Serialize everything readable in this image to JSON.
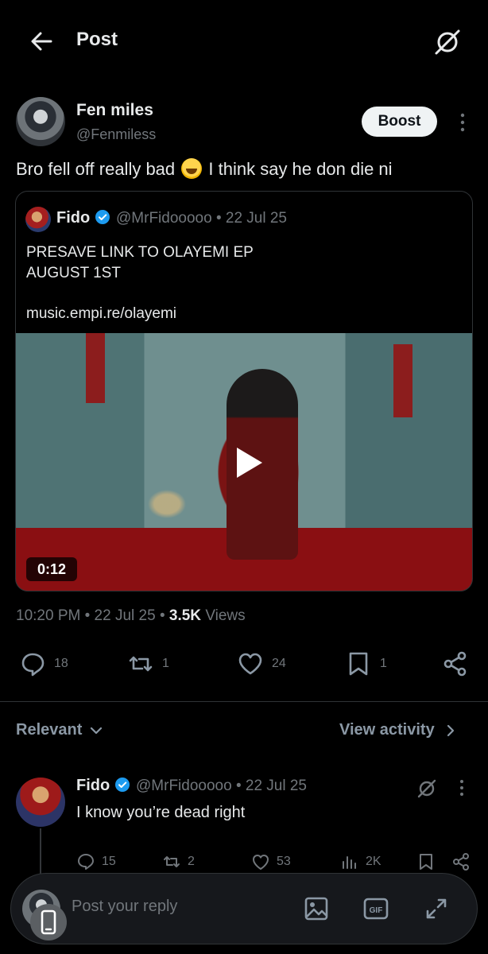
{
  "header": {
    "title": "Post",
    "back_icon": "arrow-left-icon",
    "grok_icon": "grok-icon"
  },
  "author": {
    "name": "Fen miles",
    "handle": "@Fenmiless",
    "boost_label": "Boost"
  },
  "post": {
    "text_before": "Bro fell off really bad",
    "emoji": "grinning-squinting-face-emoji",
    "text_after": "I think say he don die ni",
    "time": "10:20 PM",
    "date": "22 Jul 25",
    "views_count": "3.5K",
    "views_label": "Views"
  },
  "quote": {
    "name": "Fido",
    "handle_date": "@MrFidooooo • 22 Jul 25",
    "line1": "PRESAVE LINK TO OLAYEMI EP",
    "line2": "AUGUST 1ST",
    "link": "music.empi.re/olayemi",
    "video_duration": "0:12"
  },
  "actions": {
    "replies": "18",
    "reposts": "1",
    "likes": "24",
    "bookmarks": "1"
  },
  "replies_header": {
    "sort_label": "Relevant",
    "activity_label": "View activity"
  },
  "reply": {
    "name": "Fido",
    "handle_date": "@MrFidooooo • 22 Jul 25",
    "text": "I know you’re dead right",
    "replies": "15",
    "reposts": "2",
    "likes": "53",
    "views": "2K"
  },
  "composer": {
    "placeholder": "Post your reply"
  },
  "colors": {
    "background": "#000000",
    "muted": "#71767b",
    "verified": "#1d9bf0",
    "text": "#e7e9ea"
  }
}
